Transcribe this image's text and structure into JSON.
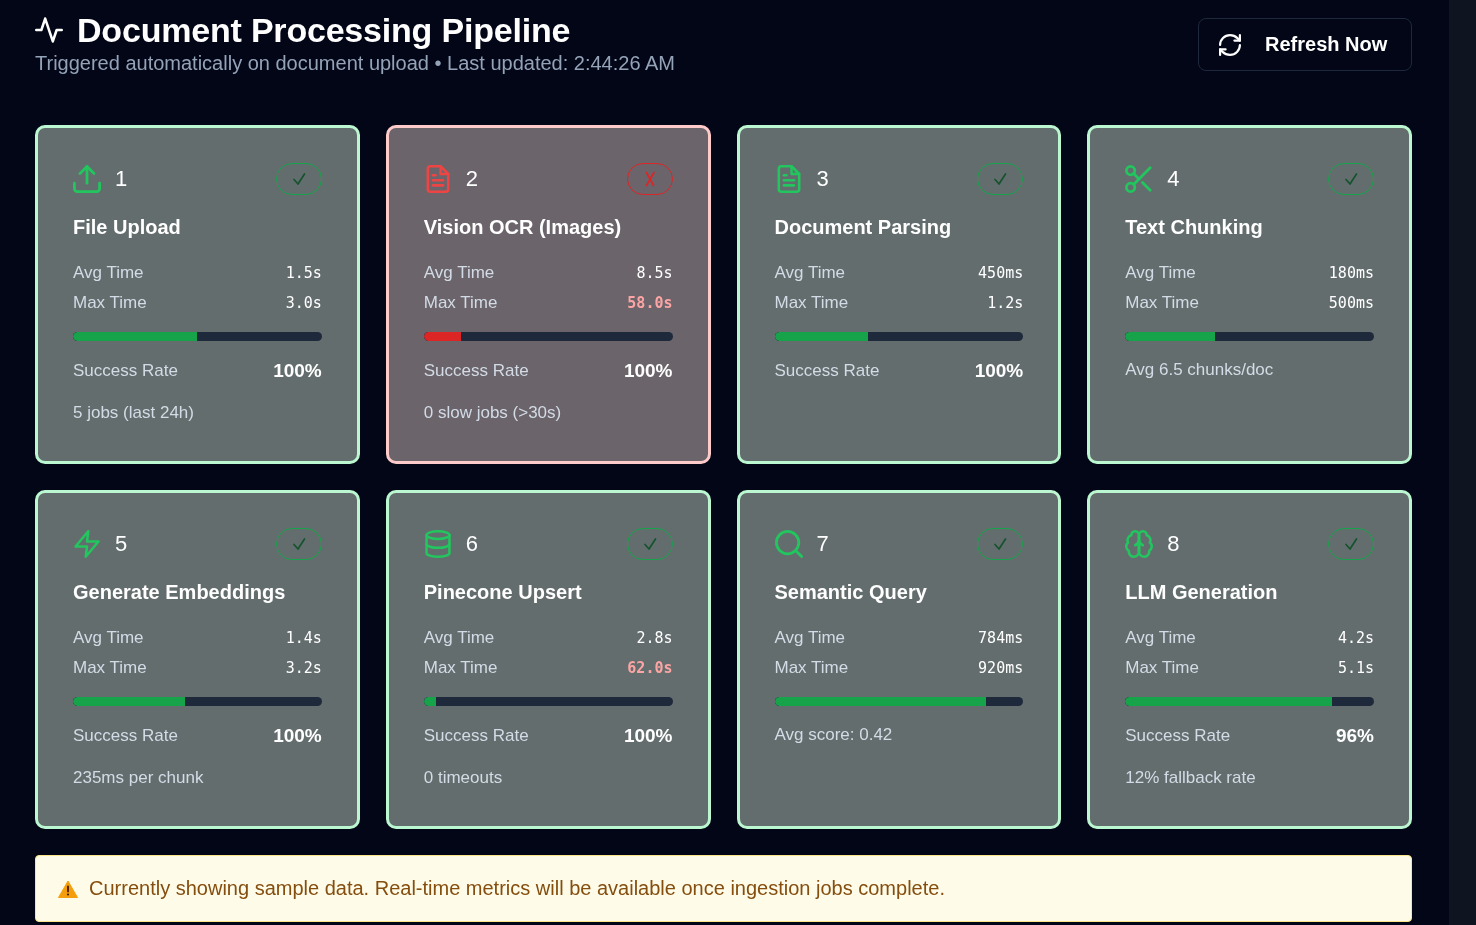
{
  "header": {
    "title": "Document Processing Pipeline",
    "subtitle": "Triggered automatically on document upload • Last updated: 2:44:26 AM"
  },
  "refresh_button": {
    "label": "Refresh Now"
  },
  "stages": [
    {
      "number": "1",
      "title": "File Upload",
      "failed": false,
      "metrics": [
        {
          "label": "Avg Time",
          "value": "1.5s",
          "slow": false
        },
        {
          "label": "Max Time",
          "value": "3.0s",
          "slow": false
        }
      ],
      "level": 0.5,
      "success_rate": {
        "label": "Success Rate",
        "value": "100%"
      },
      "note": "5 jobs (last 24h)"
    },
    {
      "number": "2",
      "title": "Vision OCR (Images)",
      "failed": true,
      "metrics": [
        {
          "label": "Avg Time",
          "value": "8.5s",
          "slow": false
        },
        {
          "label": "Max Time",
          "value": "58.0s",
          "slow": true
        }
      ],
      "level": 0.15,
      "success_rate": {
        "label": "Success Rate",
        "value": "100%"
      },
      "note": "0 slow jobs (>30s)"
    },
    {
      "number": "3",
      "title": "Document Parsing",
      "failed": false,
      "metrics": [
        {
          "label": "Avg Time",
          "value": "450ms",
          "slow": false
        },
        {
          "label": "Max Time",
          "value": "1.2s",
          "slow": false
        }
      ],
      "level": 0.375,
      "success_rate": {
        "label": "Success Rate",
        "value": "100%"
      }
    },
    {
      "number": "4",
      "title": "Text Chunking",
      "failed": false,
      "metrics": [
        {
          "label": "Avg Time",
          "value": "180ms",
          "slow": false
        },
        {
          "label": "Max Time",
          "value": "500ms",
          "slow": false
        }
      ],
      "level": 0.36,
      "note": "Avg 6.5 chunks/doc"
    },
    {
      "number": "5",
      "title": "Generate Embeddings",
      "failed": false,
      "metrics": [
        {
          "label": "Avg Time",
          "value": "1.4s",
          "slow": false
        },
        {
          "label": "Max Time",
          "value": "3.2s",
          "slow": false
        }
      ],
      "level": 0.45,
      "success_rate": {
        "label": "Success Rate",
        "value": "100%"
      },
      "note": "235ms per chunk"
    },
    {
      "number": "6",
      "title": "Pinecone Upsert",
      "failed": false,
      "metrics": [
        {
          "label": "Avg Time",
          "value": "2.8s",
          "slow": false
        },
        {
          "label": "Max Time",
          "value": "62.0s",
          "slow": true
        }
      ],
      "level": 0.05,
      "success_rate": {
        "label": "Success Rate",
        "value": "100%"
      },
      "note": "0 timeouts"
    },
    {
      "number": "7",
      "title": "Semantic Query",
      "failed": false,
      "metrics": [
        {
          "label": "Avg Time",
          "value": "784ms",
          "slow": false
        },
        {
          "label": "Max Time",
          "value": "920ms",
          "slow": false
        }
      ],
      "level": 0.85,
      "note": "Avg score: 0.42"
    },
    {
      "number": "8",
      "title": "LLM Generation",
      "failed": false,
      "metrics": [
        {
          "label": "Avg Time",
          "value": "4.2s",
          "slow": false
        },
        {
          "label": "Max Time",
          "value": "5.1s",
          "slow": false
        }
      ],
      "level": 0.83,
      "success_rate": {
        "label": "Success Rate",
        "value": "96%"
      },
      "note": "12% fallback rate"
    }
  ],
  "notice": {
    "text": "Currently showing sample data. Real-time metrics will be available once ingestion jobs complete."
  }
}
